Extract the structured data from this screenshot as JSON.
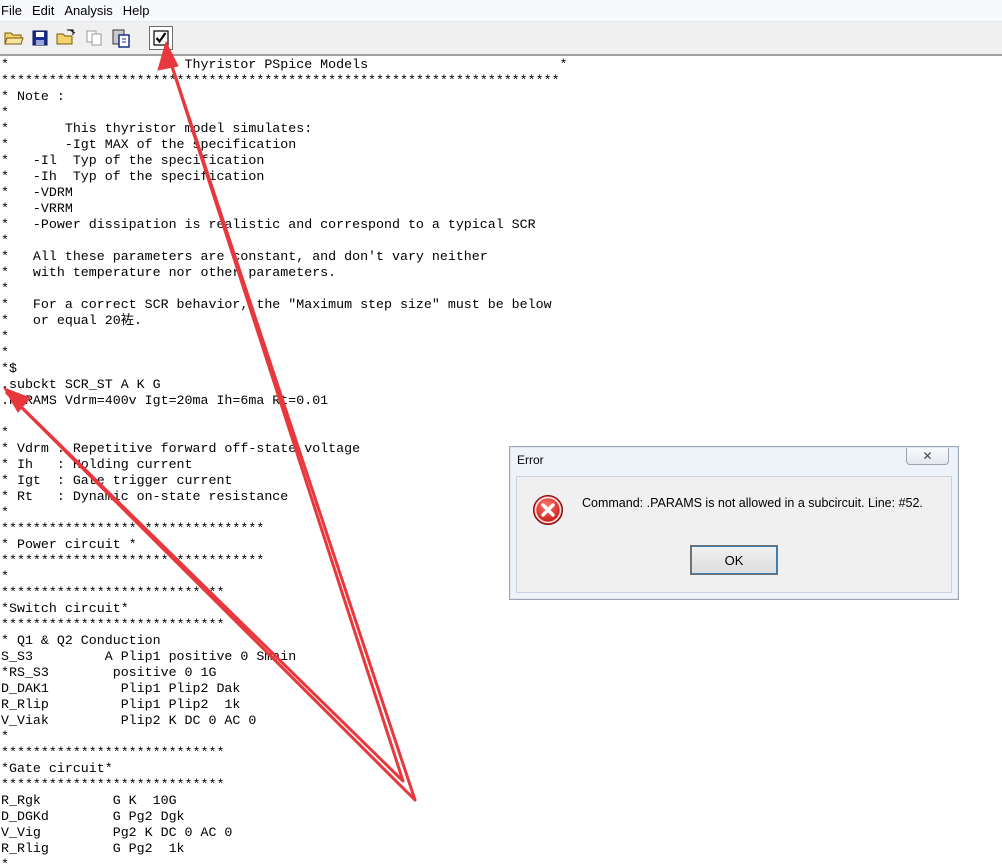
{
  "menu": {
    "items": [
      "File",
      "Edit",
      "Analysis",
      "Help"
    ]
  },
  "toolbar": {
    "buttons": [
      {
        "icon": "open-folder-icon"
      },
      {
        "icon": "save-disk-icon"
      },
      {
        "icon": "open-file-icon"
      },
      {
        "icon": "copy-icon"
      },
      {
        "icon": "paste-icon"
      },
      {
        "icon": "check-icon",
        "pressed": true
      }
    ]
  },
  "editor": {
    "lines": [
      "*                      Thyristor PSpice Models                        *",
      "**********************************************************************",
      "* Note :",
      "*",
      "*       This thyristor model simulates:",
      "*       -Igt MAX of the specification",
      "*   -Il  Typ of the specification",
      "*   -Ih  Typ of the specification",
      "*   -VDRM",
      "*   -VRRM",
      "*   -Power dissipation is realistic and correspond to a typical SCR",
      "*",
      "*   All these parameters are constant, and don't vary neither",
      "*   with temperature nor other parameters.",
      "*",
      "*   For a correct SCR behavior, the \"Maximum step size\" must be below",
      "*   or equal 20袏.",
      "*",
      "*",
      "*$",
      ".subckt SCR_ST A K G",
      ".PARAMS Vdrm=400v Igt=20ma Ih=6ma Rt=0.01",
      "",
      "*",
      "* Vdrm : Repetitive forward off-state voltage",
      "* Ih   : Holding current",
      "* Igt  : Gate trigger current",
      "* Rt   : Dynamic on-state resistance",
      "*",
      "*********************************",
      "* Power circuit *",
      "*********************************",
      "*",
      "****************************",
      "*Switch circuit*",
      "****************************",
      "* Q1 & Q2 Conduction",
      "S_S3         A Plip1 positive 0 Smain",
      "*RS_S3        positive 0 1G",
      "D_DAK1         Plip1 Plip2 Dak",
      "R_Rlip         Plip1 Plip2  1k",
      "V_Viak         Plip2 K DC 0 AC 0",
      "*",
      "****************************",
      "*Gate circuit*",
      "****************************",
      "R_Rgk         G K  10G",
      "D_DGKd        G Pg2 Dgk",
      "V_Vig         Pg2 K DC 0 AC 0",
      "R_Rlig        G Pg2  1k",
      "*"
    ]
  },
  "dialog": {
    "title": "Error",
    "close_label": "✕",
    "message": "Command: .PARAMS is not allowed in a subcircuit. Line: #52.",
    "ok_label": "OK",
    "icon": "error-icon"
  },
  "annotation": {
    "color": "#e8383d",
    "description_icon": "red-arrow"
  }
}
